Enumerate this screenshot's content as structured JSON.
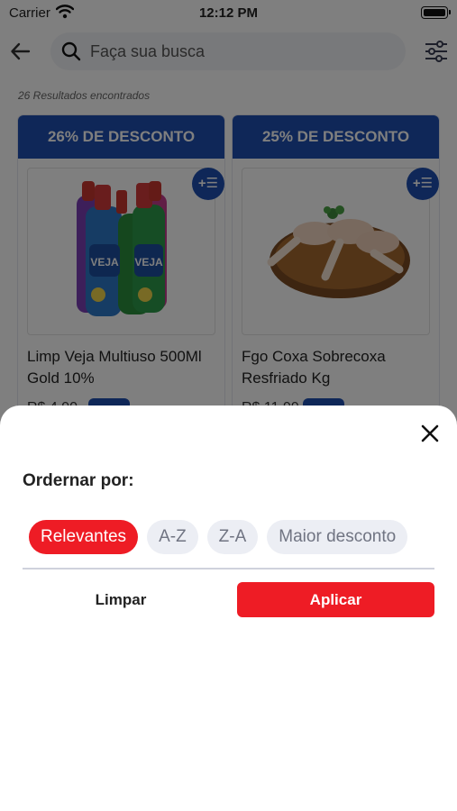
{
  "status_bar": {
    "carrier": "Carrier",
    "time": "12:12 PM"
  },
  "header": {
    "back_icon": "arrow-left-icon",
    "search_icon": "search-icon",
    "search_placeholder": "Faça sua busca",
    "filter_icon": "sliders-icon"
  },
  "results": {
    "count_text": "26 Resultados encontrados"
  },
  "products": [
    {
      "discount": "26% DE DESCONTO",
      "name": "Limp Veja Multiuso 500Ml Gold 10%",
      "price": "R$ 4,90",
      "add_label": "+☰"
    },
    {
      "discount": "25% DE DESCONTO",
      "name": "Fgo Coxa Sobrecoxa Resfriado Kg",
      "price": "R$ 11,99",
      "add_label": "+☰"
    }
  ],
  "sort_sheet": {
    "close_icon": "close-icon",
    "title": "Ordernar por:",
    "options": [
      "Relevantes",
      "A-Z",
      "Z-A",
      "Maior desconto"
    ],
    "selected": "Relevantes",
    "clear_label": "Limpar",
    "apply_label": "Aplicar"
  },
  "colors": {
    "accent_red": "#ee1c25",
    "brand_blue": "#1e4fb0",
    "chip_bg": "#eceef4"
  }
}
